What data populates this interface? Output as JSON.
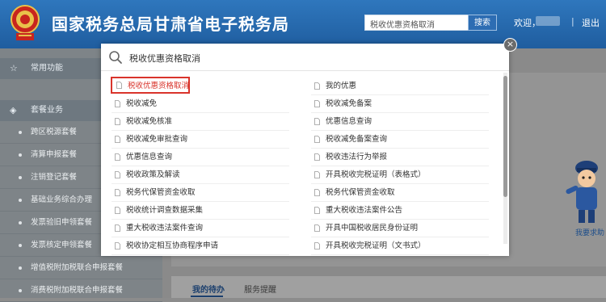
{
  "header": {
    "title": "国家税务总局甘肃省电子税务局",
    "search_value": "税收优惠资格取消",
    "search_button": "搜索",
    "welcome": "欢迎，",
    "separator": "|",
    "logout": "退出"
  },
  "sidebar": {
    "favorites": "常用功能",
    "packages": "套餐业务",
    "items": [
      "跨区税源套餐",
      "清算申报套餐",
      "注销登记套餐",
      "基础业务综合办理",
      "发票验旧申领套餐",
      "发票核定申领套餐",
      "增值税附加税联合申报套餐",
      "消费税附加税联合申报套餐"
    ]
  },
  "main": {
    "tab_active": "我的待办",
    "tab_other": "服务提醒",
    "mascot_label": "我要求助"
  },
  "modal": {
    "query": "税收优惠资格取消",
    "close": "×",
    "left_results": [
      "税收优惠资格取消",
      "税收减免",
      "税收减免核准",
      "税收减免审批查询",
      "优惠信息查询",
      "税收政策及解读",
      "税务代保管资金收取",
      "税收统计调查数据采集",
      "重大税收违法案件查询",
      "税收协定相互协商程序申请"
    ],
    "right_results": [
      "我的优惠",
      "税收减免备案",
      "优惠信息查询",
      "税收减免备案查询",
      "税收违法行为举报",
      "开具税收完税证明（表格式）",
      "税务代保管资金收取",
      "重大税收违法案件公告",
      "开具中国税收居民身份证明",
      "开具税收完税证明（文书式）"
    ]
  },
  "colors": {
    "header_blue": "#2f77bd",
    "highlight_red": "#d9342b",
    "overlay_grey": "#8a8a8a"
  }
}
